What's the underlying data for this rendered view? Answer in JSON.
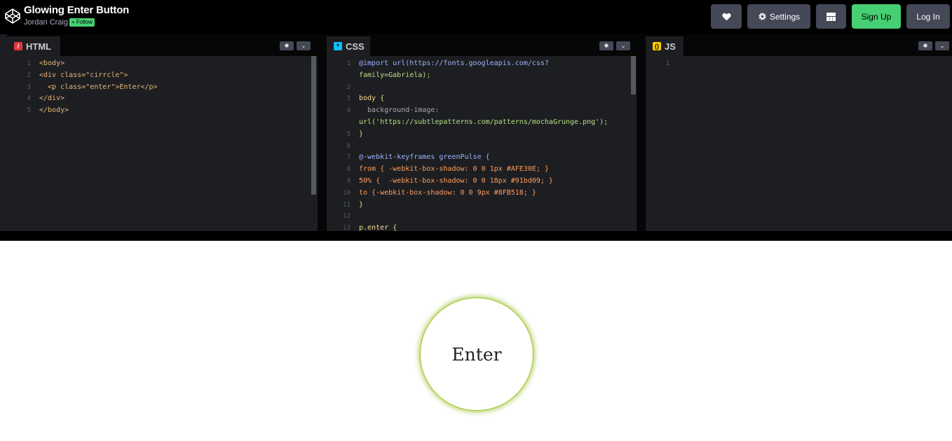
{
  "header": {
    "title": "Glowing Enter Button",
    "author": "Jordan Craig",
    "follow_label": "Follow",
    "follow_icon": "plus-icon",
    "buttons": {
      "heart_icon": "heart-icon",
      "settings_label": "Settings",
      "settings_icon": "gear-icon",
      "layout_icon": "layout-icon",
      "signup_label": "Sign Up",
      "login_label": "Log In"
    }
  },
  "editors": {
    "html": {
      "label": "HTML",
      "accent": "#e0383e",
      "lines": [
        {
          "n": "1",
          "t": "<body>"
        },
        {
          "n": "2",
          "t": "<div class=\"cirrcle\">"
        },
        {
          "n": "3",
          "t": "  <p class=\"enter\">Enter</p>"
        },
        {
          "n": "4",
          "t": "</div>"
        },
        {
          "n": "5",
          "t": "</body>"
        }
      ]
    },
    "css": {
      "label": "CSS",
      "accent": "#0ebeff",
      "lines": [
        {
          "n": "1",
          "t": "@import url(https://fonts.googleapis.com/css?"
        },
        {
          "n": "",
          "t": "family=Gabriela);"
        },
        {
          "n": "2",
          "t": ""
        },
        {
          "n": "3",
          "t": "body {"
        },
        {
          "n": "4",
          "t": "  background-image:"
        },
        {
          "n": "",
          "t": "url('https://subtlepatterns.com/patterns/mochaGrunge.png');"
        },
        {
          "n": "5",
          "t": "}"
        },
        {
          "n": "6",
          "t": ""
        },
        {
          "n": "7",
          "t": "@-webkit-keyframes greenPulse {"
        },
        {
          "n": "8",
          "t": "from { -webkit-box-shadow: 0 0 1px #AFE30E; }"
        },
        {
          "n": "9",
          "t": "50% {  -webkit-box-shadow: 0 0 18px #91bd09; }"
        },
        {
          "n": "10",
          "t": "to {-webkit-box-shadow: 0 0 9px #8FB518; }"
        },
        {
          "n": "11",
          "t": "}"
        },
        {
          "n": "12",
          "t": ""
        },
        {
          "n": "13",
          "t": "p.enter {"
        }
      ]
    },
    "js": {
      "label": "JS",
      "accent": "#fcd000",
      "lines": [
        {
          "n": "1",
          "t": ""
        }
      ]
    }
  },
  "preview": {
    "button_text": "Enter",
    "glow_color": "#8FB518"
  }
}
